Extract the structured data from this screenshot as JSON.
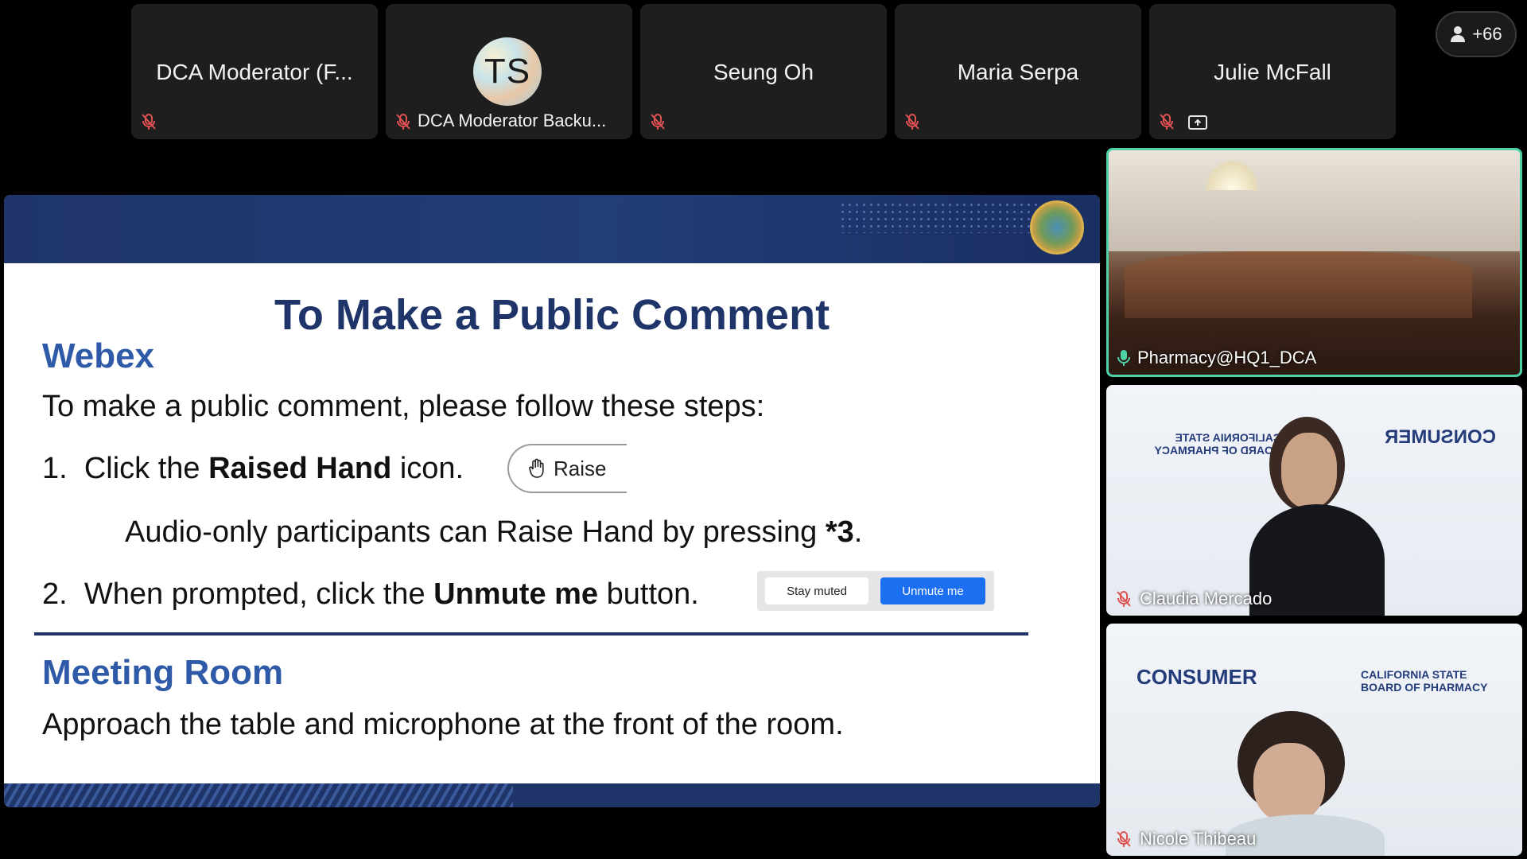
{
  "participants_strip": [
    {
      "name": "DCA Moderator (F...",
      "muted": true
    },
    {
      "initials": "TS",
      "name": "DCA Moderator Backu...",
      "muted": true
    },
    {
      "name": "Seung Oh",
      "muted": true
    },
    {
      "name": "Maria Serpa",
      "muted": true
    },
    {
      "name": "Julie McFall",
      "muted": true,
      "sharing_icon": true
    }
  ],
  "more_participants": "+66",
  "slide": {
    "title": "To Make a Public Comment",
    "webex_heading": "Webex",
    "intro": "To make a public comment, please follow these steps:",
    "step1": {
      "num": "1.",
      "pre": "Click the ",
      "bold": "Raised Hand",
      "post": " icon."
    },
    "raise_button_label": "Raise",
    "audio_only": {
      "pre": "Audio-only participants can Raise Hand by pressing ",
      "bold": "*3",
      "post": "."
    },
    "step2": {
      "num": "2.",
      "pre": "When prompted, click the ",
      "bold": "Unmute me",
      "post": " button."
    },
    "stay_muted_label": "Stay muted",
    "unmute_label": "Unmute me",
    "meeting_heading": "Meeting Room",
    "meeting_text": "Approach the table and microphone at the front of the room."
  },
  "video_tiles": [
    {
      "name": "Pharmacy@HQ1_DCA",
      "active_speaker": true,
      "mic_on": true
    },
    {
      "name": "Claudia Mercado",
      "muted": true,
      "background_logos": [
        "CALIFORNIA STATE BOARD OF PHARMACY",
        "CALIFORNIA DEPARTMENT OF CONSUMER AFFAIRS"
      ]
    },
    {
      "name": "Nicole Thibeau",
      "muted": true,
      "background_logos": [
        "CALIFORNIA DEPARTMENT OF CONSUMER AFFAIRS",
        "CALIFORNIA STATE BOARD OF PHARMACY"
      ]
    }
  ],
  "colors": {
    "slide_navy": "#1f3569",
    "heading_blue": "#2f5aa8",
    "active_speaker_border": "#4fd1a7",
    "muted_icon": "#e05252",
    "unmute_blue": "#1b6ff0"
  }
}
